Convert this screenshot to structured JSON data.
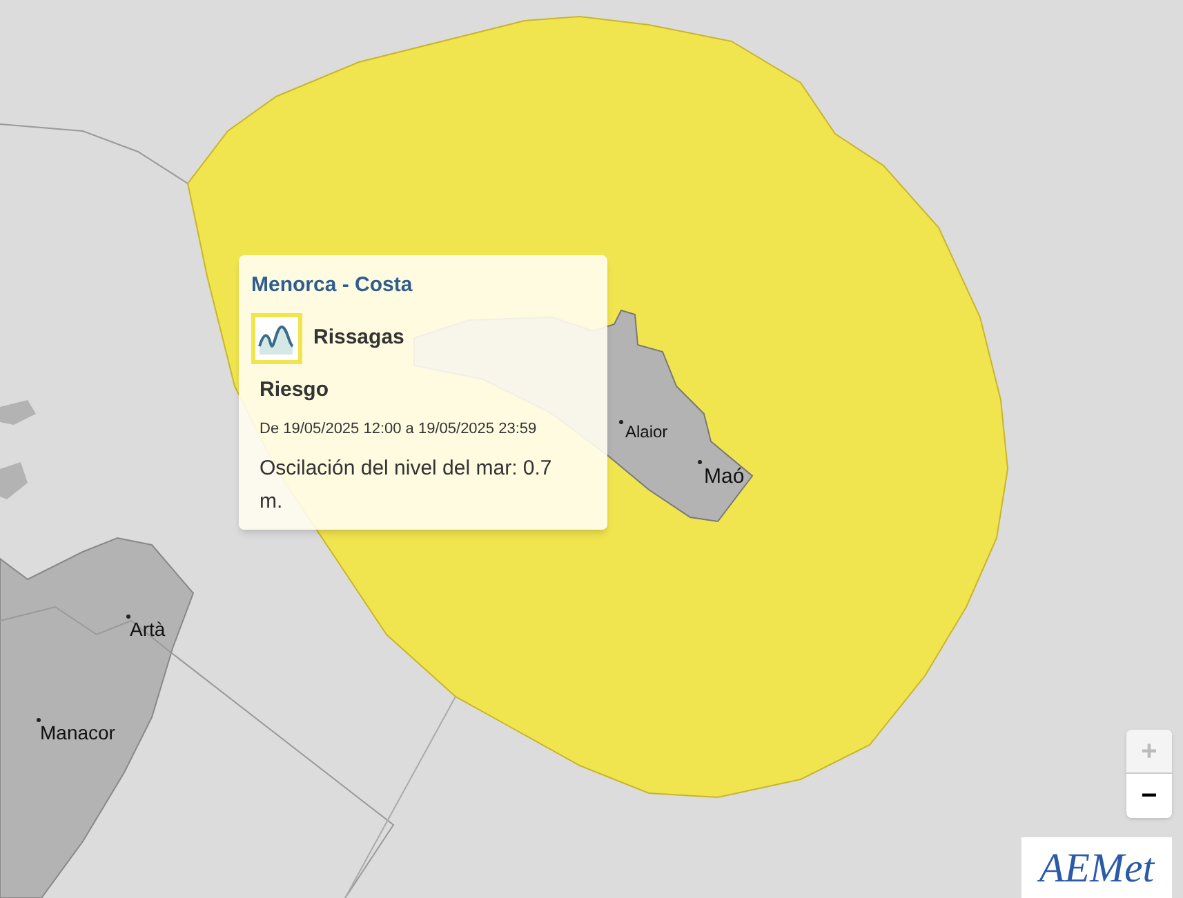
{
  "map_labels": [
    {
      "text": "Alaior"
    },
    {
      "text": "Maó"
    },
    {
      "text": "Artà"
    },
    {
      "text": "Manacor"
    }
  ],
  "popup": {
    "zone": "Menorca - Costa",
    "phenomenon": "Rissagas",
    "section": "Riesgo",
    "period": "De 19/05/2025 12:00 a 19/05/2025 23:59",
    "description": "Oscilación del nivel del mar: 0.7 m."
  },
  "zoom": [
    {
      "symbol": "+",
      "disabled": true
    },
    {
      "symbol": "−",
      "disabled": false
    }
  ],
  "logo": {
    "text": "AEMet"
  }
}
